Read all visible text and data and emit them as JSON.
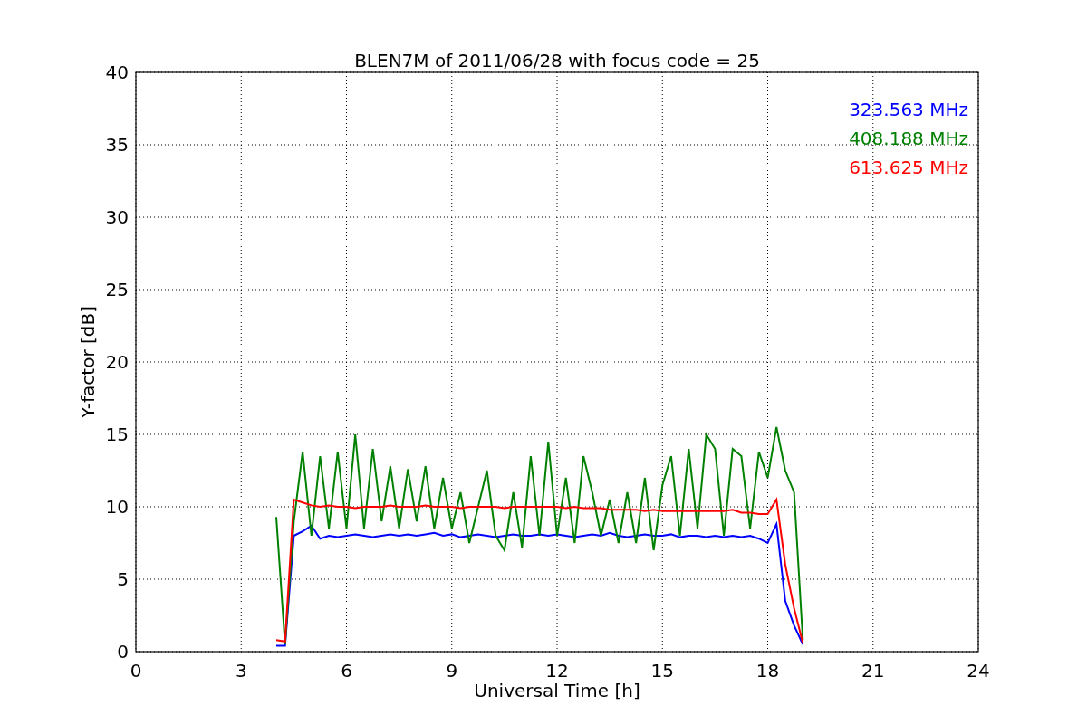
{
  "chart_data": {
    "type": "line",
    "title": "BLEN7M of 2011/06/28 with focus code = 25",
    "xlabel": "Universal Time [h]",
    "ylabel": "Y-factor [dB]",
    "x": [
      4.0,
      4.25,
      4.5,
      4.75,
      5.0,
      5.25,
      5.5,
      5.75,
      6.0,
      6.25,
      6.5,
      6.75,
      7.0,
      7.25,
      7.5,
      7.75,
      8.0,
      8.25,
      8.5,
      8.75,
      9.0,
      9.25,
      9.5,
      9.75,
      10.0,
      10.25,
      10.5,
      10.75,
      11.0,
      11.25,
      11.5,
      11.75,
      12.0,
      12.25,
      12.5,
      12.75,
      13.0,
      13.25,
      13.5,
      13.75,
      14.0,
      14.25,
      14.5,
      14.75,
      15.0,
      15.25,
      15.5,
      15.75,
      16.0,
      16.25,
      16.5,
      16.75,
      17.0,
      17.25,
      17.5,
      17.75,
      18.0,
      18.25,
      18.5,
      18.75,
      19.0
    ],
    "series": [
      {
        "name": "323.563 MHz",
        "color": "#0000ff",
        "values": [
          0.4,
          0.4,
          8.0,
          8.3,
          8.7,
          7.8,
          8.0,
          7.9,
          8.0,
          8.1,
          8.0,
          7.9,
          8.0,
          8.1,
          8.0,
          8.1,
          8.0,
          8.1,
          8.2,
          8.0,
          8.1,
          7.9,
          8.0,
          8.1,
          8.0,
          7.9,
          8.0,
          8.1,
          8.0,
          8.0,
          8.1,
          8.0,
          8.1,
          8.0,
          7.9,
          8.0,
          8.1,
          8.0,
          8.2,
          8.0,
          7.9,
          8.0,
          8.1,
          8.0,
          8.0,
          8.1,
          7.9,
          8.0,
          8.0,
          7.9,
          8.0,
          7.9,
          8.0,
          7.9,
          8.0,
          7.8,
          7.5,
          8.8,
          3.5,
          1.8,
          0.5
        ]
      },
      {
        "name": "408.188 MHz",
        "color": "#008000",
        "values": [
          9.3,
          0.5,
          9.0,
          13.8,
          8.0,
          13.5,
          8.5,
          13.8,
          8.5,
          15.0,
          8.5,
          14.0,
          9.0,
          12.8,
          8.5,
          12.6,
          9.0,
          12.8,
          8.5,
          12.0,
          8.5,
          11.0,
          7.5,
          10.0,
          12.5,
          8.0,
          7.0,
          11.0,
          7.2,
          13.5,
          8.0,
          14.5,
          8.0,
          12.0,
          7.5,
          13.5,
          11.0,
          8.0,
          10.5,
          7.5,
          11.0,
          7.5,
          12.0,
          7.0,
          11.5,
          13.5,
          8.0,
          14.0,
          8.5,
          15.0,
          14.0,
          8.0,
          14.0,
          13.5,
          8.5,
          13.8,
          12.0,
          15.5,
          12.5,
          11.0,
          0.8
        ]
      },
      {
        "name": "613.625 MHz",
        "color": "#ff0000",
        "values": [
          0.8,
          0.7,
          10.5,
          10.3,
          10.1,
          10.0,
          10.1,
          10.0,
          10.0,
          9.9,
          10.0,
          10.0,
          10.0,
          10.1,
          10.0,
          10.0,
          10.0,
          10.1,
          10.0,
          10.0,
          10.0,
          9.9,
          10.0,
          10.0,
          10.0,
          10.0,
          9.9,
          10.0,
          10.0,
          10.0,
          10.0,
          10.0,
          10.0,
          9.9,
          10.0,
          9.9,
          9.9,
          9.9,
          9.8,
          9.8,
          9.8,
          9.8,
          9.7,
          9.8,
          9.7,
          9.7,
          9.7,
          9.7,
          9.7,
          9.7,
          9.7,
          9.7,
          9.8,
          9.6,
          9.6,
          9.5,
          9.5,
          10.5,
          6.0,
          3.0,
          0.6
        ]
      }
    ],
    "grid": true,
    "xlim": [
      0,
      24
    ],
    "ylim": [
      0,
      40
    ],
    "xticks": [
      0,
      3,
      6,
      9,
      12,
      15,
      18,
      21,
      24
    ],
    "yticks": [
      0,
      5,
      10,
      15,
      20,
      25,
      30,
      35,
      40
    ]
  }
}
